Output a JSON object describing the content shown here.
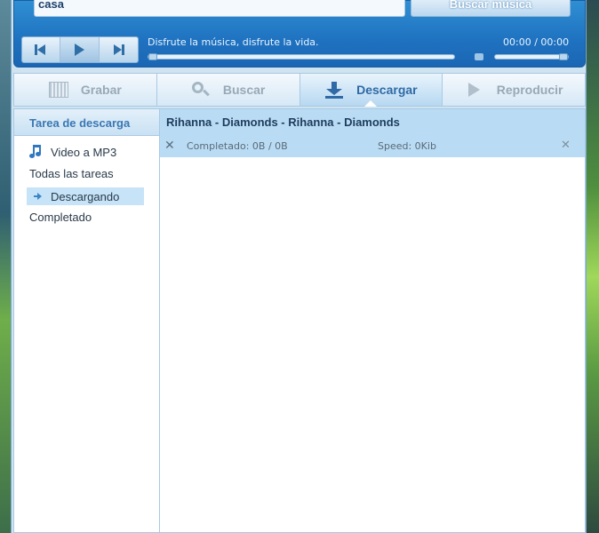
{
  "search": {
    "value": "casa",
    "button_label": "Buscar música"
  },
  "player": {
    "slogan": "Disfrute la música, disfrute la vida.",
    "time": "00:00 / 00:00",
    "progress": 0,
    "volume": 1
  },
  "tabs": [
    {
      "label": "Grabar",
      "icon": "record-icon",
      "active": false
    },
    {
      "label": "Buscar",
      "icon": "search-icon",
      "active": false
    },
    {
      "label": "Descargar",
      "icon": "download-icon",
      "active": true
    },
    {
      "label": "Reproducir",
      "icon": "play-icon",
      "active": false
    }
  ],
  "sidebar": {
    "header": "Tarea de descarga",
    "items": [
      {
        "label": "Video a MP3",
        "icon": "music-note-icon"
      },
      {
        "label": "Todas las tareas"
      },
      {
        "label": "Descargando",
        "icon": "arrow-right-icon",
        "selected": true
      },
      {
        "label": "Completado"
      }
    ]
  },
  "downloads": [
    {
      "title": "Rihanna - Diamonds - Rihanna - Diamonds",
      "status": "Completado: 0B / 0B",
      "speed": "Speed: 0Kib"
    }
  ],
  "colors": {
    "accent": "#2f6aa6",
    "player_blue": "#1f72c0",
    "row_selected": "#b9dcf4"
  }
}
